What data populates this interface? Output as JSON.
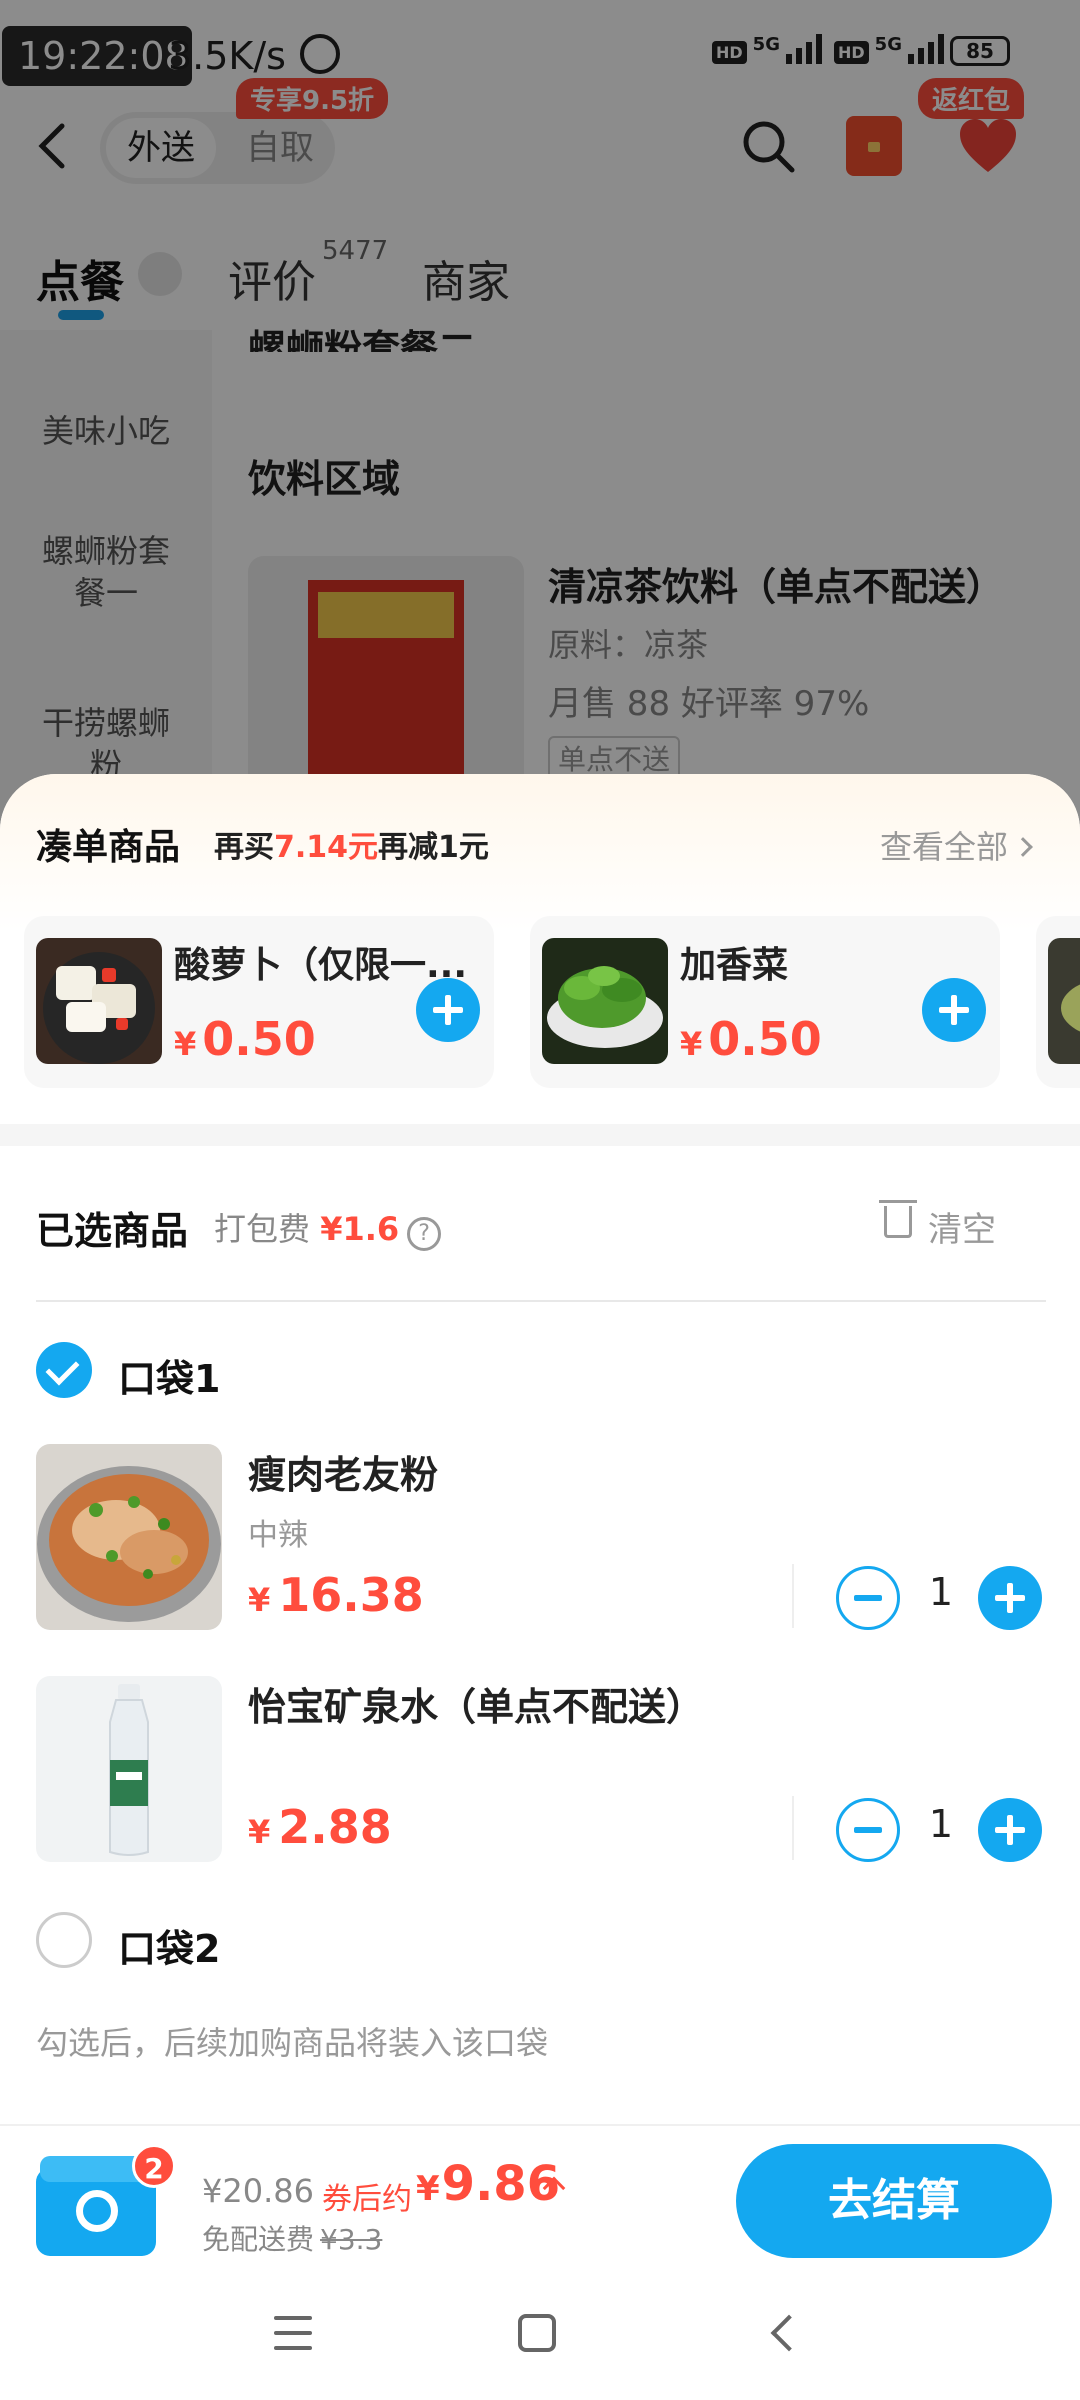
{
  "status_bar": {
    "time": "19:22:08",
    "network_speed": "3.5K/s",
    "battery": "85",
    "sim1_hd": "HD",
    "sim1_net": "5G",
    "sim2_hd": "HD",
    "sim2_net": "5G"
  },
  "nav": {
    "mode_active": "外送",
    "mode_inactive": "自取",
    "promo_tag": "专享9.5折",
    "return_tag": "返红包"
  },
  "tabs": {
    "order": "点餐",
    "reviews": "评价",
    "review_count": "5477",
    "store": "商家"
  },
  "side_menu": {
    "items": [
      "美味小吃",
      "螺蛳粉套餐一",
      "干捞螺蛳粉"
    ]
  },
  "background_content": {
    "cut_title": "螺蛳粉套餐二",
    "section_title": "饮料区域",
    "product_name": "清凉茶饮料（单点不配送）",
    "product_ingredient": "原料：凉茶",
    "product_sales": "月售 88 好评率 97%",
    "product_badge": "单点不送"
  },
  "addon": {
    "title": "凑单商品",
    "promo_prefix": "再买",
    "promo_amount": "7.14元",
    "promo_suffix": "再减1元",
    "view_all": "查看全部",
    "currency": "¥",
    "items": [
      {
        "name": "酸萝卜（仅限一...",
        "price": "0.50"
      },
      {
        "name": "加香菜",
        "price": "0.50"
      }
    ]
  },
  "cart": {
    "title": "已选商品",
    "pack_fee_label": "打包费",
    "pack_fee": "¥1.6",
    "help": "?",
    "clear": "清空",
    "bag1": "口袋1",
    "bag2": "口袋2",
    "currency": "¥",
    "items": [
      {
        "name": "瘦肉老友粉",
        "spec": "中辣",
        "price": "16.38",
        "qty": "1"
      },
      {
        "name": "怡宝矿泉水（单点不配送）",
        "spec": "",
        "price": "2.88",
        "qty": "1"
      }
    ],
    "hint": "勾选后，后续加购商品将装入该口袋"
  },
  "checkout": {
    "badge": "2",
    "original_total": "¥20.86",
    "after_label": "券后约",
    "currency": "¥",
    "after_price": "9.86",
    "delivery_label": "免配送费",
    "delivery_original": "¥3.3",
    "button": "去结算"
  },
  "colors": {
    "accent_blue": "#14a8f0",
    "price_red": "#ff4d3d"
  }
}
